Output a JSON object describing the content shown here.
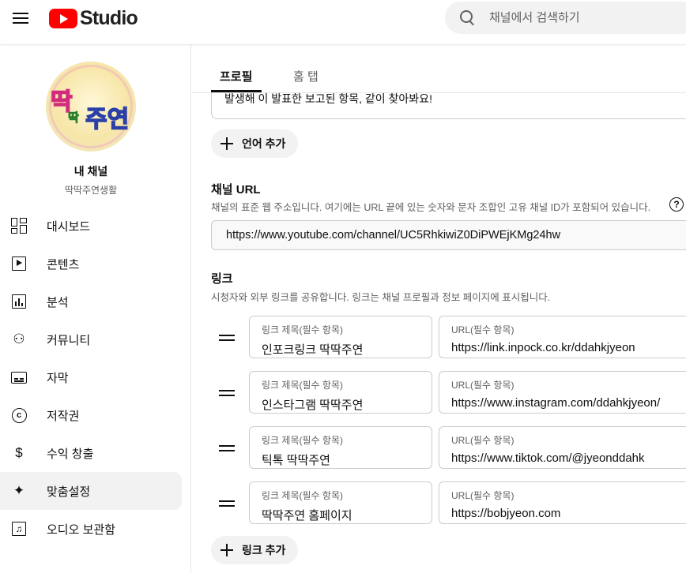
{
  "header": {
    "logo_text": "Studio",
    "search_placeholder": "채널에서 검색하기"
  },
  "sidebar": {
    "avatar_text": [
      "딱",
      "딱",
      "주연"
    ],
    "channel_label": "내 채널",
    "channel_name": "딱딱주연생활",
    "items": [
      {
        "label": "대시보드",
        "icon": "dashboard-icon"
      },
      {
        "label": "콘텐츠",
        "icon": "content-icon"
      },
      {
        "label": "분석",
        "icon": "analytics-icon"
      },
      {
        "label": "커뮤니티",
        "icon": "community-icon"
      },
      {
        "label": "자막",
        "icon": "subtitles-icon"
      },
      {
        "label": "저작권",
        "icon": "copyright-icon"
      },
      {
        "label": "수익 창출",
        "icon": "monetization-icon"
      },
      {
        "label": "맞춤설정",
        "icon": "customization-icon",
        "active": true
      },
      {
        "label": "오디오 보관함",
        "icon": "audio-library-icon"
      }
    ]
  },
  "tabs": [
    {
      "label": "프로필",
      "active": true
    },
    {
      "label": "홈 탭",
      "active": false
    }
  ],
  "description_partial": "발생해 이 발표한 보고된 항목, 같이 찾아봐요!",
  "add_language_label": "언어 추가",
  "channel_url": {
    "title": "채널 URL",
    "description": "채널의 표준 웹 주소입니다. 여기에는 URL 끝에 있는 숫자와 문자 조합인 고유 채널 ID가 포함되어 있습니다.",
    "value": "https://www.youtube.com/channel/UC5RhkiwiZ0DiPWEjKMg24hw"
  },
  "links": {
    "title": "링크",
    "description": "시청자와 외부 링크를 공유합니다. 링크는 채널 프로필과 정보 페이지에 표시됩니다.",
    "title_field_label": "링크 제목(필수 항목)",
    "url_field_label": "URL(필수 항목)",
    "items": [
      {
        "title": "인포크링크 딱딱주연",
        "url": "https://link.inpock.co.kr/ddahkjyeon"
      },
      {
        "title": "인스타그램 딱딱주연",
        "url": "https://www.instagram.com/ddahkjyeon/"
      },
      {
        "title": "틱톡 딱딱주연",
        "url": "https://www.tiktok.com/@jyeonddahk"
      },
      {
        "title": "딱딱주연 홈페이지",
        "url": "https://bobjyeon.com"
      }
    ],
    "add_link_label": "링크 추가"
  },
  "colors": {
    "brand_red": "#ff0000",
    "text_primary": "#0f0f0f",
    "text_secondary": "#606060",
    "active_bg": "#f2f2f2"
  }
}
